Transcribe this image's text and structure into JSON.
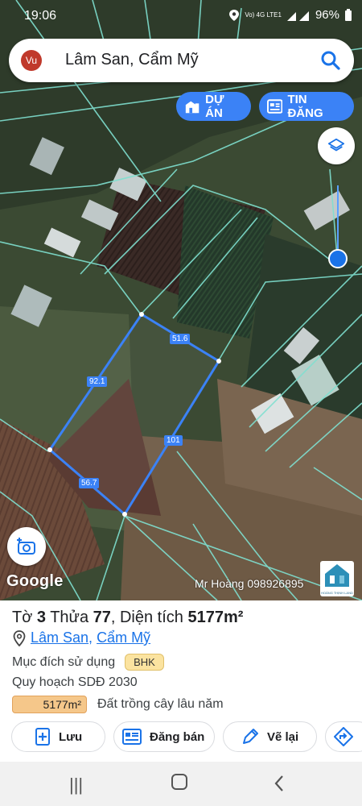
{
  "status": {
    "time": "19:06",
    "net": "Vo) 4G LTE1",
    "battery": "96%"
  },
  "search": {
    "avatar": "Vu",
    "query": "Lâm San, Cẩm Mỹ",
    "icon": "search-icon"
  },
  "chips": {
    "project": "DỰ ÁN",
    "listing": "TIN ĐĂNG"
  },
  "map": {
    "edge_labels": [
      "51.6",
      "92.1",
      "101",
      "56.7"
    ],
    "google": "Google",
    "credit": "Mr Hoàng 098926895",
    "logo_text": "HOÀNG THỊNH LAND"
  },
  "sheet": {
    "title_pre": "Tờ ",
    "sheet_no": "3",
    "title_mid": " Thửa ",
    "parcel_no": "77",
    "title_mid2": ", Diện tích ",
    "area": "5177m²",
    "loc1": "Lâm San",
    "loc_sep": ", ",
    "loc2": "Cẩm Mỹ",
    "purpose_label": "Mục đích sử dụng",
    "purpose_badge": "BHK",
    "plan_label": "Quy hoạch SDĐ 2030",
    "plan_area": "5177m²",
    "plan_desc": "Đất trồng cây lâu năm"
  },
  "actions": {
    "save": "Lưu",
    "post": "Đăng bán",
    "draw": "Vẽ lại"
  },
  "colors": {
    "accent": "#3b82f6",
    "boundary": "#7fe0d0"
  }
}
